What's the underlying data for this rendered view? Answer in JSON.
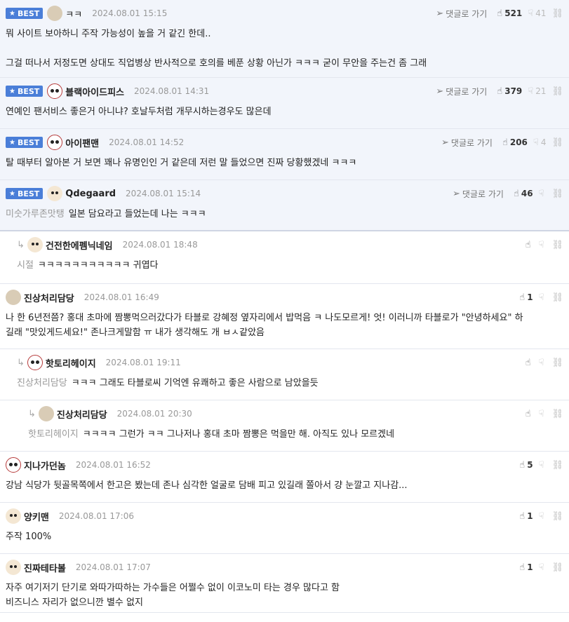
{
  "ui": {
    "best_label": "BEST",
    "goto_label": "댓글로 가기"
  },
  "comments": [
    {
      "best": true,
      "nick": "ㅋㅋ",
      "nick_plain": true,
      "avatar": "blob",
      "date": "2024.08.01 15:15",
      "goto": true,
      "likes": "521",
      "dislikes": "41",
      "lines": [
        "뭐 사이트 보아하니 주작 가능성이 높을 거 같긴 한데..",
        "",
        "그걸 떠나서 저정도면 상대도 직업병상 반사적으로 호의를 베푼 상황 아닌가 ㅋㅋㅋ 굳이 무안을 주는건 좀 그래"
      ]
    },
    {
      "best": true,
      "nick": "블랙아이드피스",
      "avatar": "mask",
      "date": "2024.08.01 14:31",
      "goto": true,
      "likes": "379",
      "dislikes": "21",
      "lines": [
        "연예인 팬서비스 좋은거 아니냐? 호날두처럼 개무시하는경우도 많은데"
      ]
    },
    {
      "best": true,
      "nick": "아이팬맨",
      "avatar": "mask",
      "date": "2024.08.01 14:52",
      "goto": true,
      "likes": "206",
      "dislikes": "4",
      "lines": [
        "탈 때부터 알아본 거 보면 꽤나 유명인인 거 같은데 저런 말 들었으면 진짜 당황했겠네 ㅋㅋㅋ"
      ]
    },
    {
      "best": true,
      "nick": "Qdegaard",
      "avatar": "dog",
      "date": "2024.08.01 15:14",
      "goto": true,
      "likes": "46",
      "dislikes": "",
      "ref": "미숫가루존맛탱",
      "lines": [
        "일본 담요라고 들었는데 나는 ㅋㅋㅋ"
      ]
    },
    {
      "reply": 1,
      "nick": "건전한에펨닉네임",
      "avatar": "dog",
      "date": "2024.08.01 18:48",
      "likes": "",
      "dislikes": "",
      "ref": "시절",
      "lines": [
        "ㅋㅋㅋㅋㅋㅋㅋㅋㅋㅋㅋ 귀엽다"
      ]
    },
    {
      "nick": "진상처리담당",
      "avatar": "blob",
      "date": "2024.08.01 16:49",
      "likes": "1",
      "dislikes": "",
      "lines": [
        "나 한 6년전쯤? 홍대 초마에 짬뽕먹으러갔다가 타블로 강혜정 옆자리에서 밥먹음 ㅋ 나도모르게! 엇! 이러니까 타블로가 \"안녕하세요\" 하",
        "길래 \"맛있게드세요!\" 존나크게말함 ㅠ 내가 생각해도 개 ㅂㅅ같았음"
      ]
    },
    {
      "reply": 1,
      "nick": "핫토리헤이지",
      "avatar": "mask",
      "date": "2024.08.01 19:11",
      "likes": "",
      "dislikes": "",
      "ref": "진상처리담당",
      "lines": [
        "ㅋㅋㅋ 그래도 타블로씨 기억엔 유쾌하고 좋은 사람으로 남았을듯"
      ]
    },
    {
      "reply": 2,
      "nick": "진상처리담당",
      "avatar": "blob",
      "date": "2024.08.01 20:30",
      "likes": "",
      "dislikes": "",
      "ref": "핫토리헤이지",
      "lines": [
        "ㅋㅋㅋㅋ 그런가 ㅋㅋ 그나저나 홍대 초마 짬뽕은 먹을만 해. 아직도 있나 모르겠네"
      ]
    },
    {
      "nick": "지나가던놈",
      "avatar": "mask",
      "date": "2024.08.01 16:52",
      "likes": "5",
      "dislikes": "",
      "lines": [
        "강남 식당가 뒷골목쪽에서 한고은 봤는데 존나 심각한 얼굴로 담배 피고 있길래 쫄아서 걍 눈깔고 지나감..."
      ]
    },
    {
      "nick": "양키맨",
      "avatar": "dog",
      "date": "2024.08.01 17:06",
      "likes": "1",
      "dislikes": "",
      "lines": [
        "주작 100%"
      ]
    },
    {
      "nick": "진짜테타볼",
      "avatar": "dog",
      "date": "2024.08.01 17:07",
      "likes": "1",
      "dislikes": "",
      "lines": [
        "자주 여기저기 단기로 와따가따하는 가수들은 어쩔수 없이 이코노미 타는 경우 많다고 함",
        "비즈니스 자리가 없으니깐 별수 없지"
      ]
    }
  ]
}
